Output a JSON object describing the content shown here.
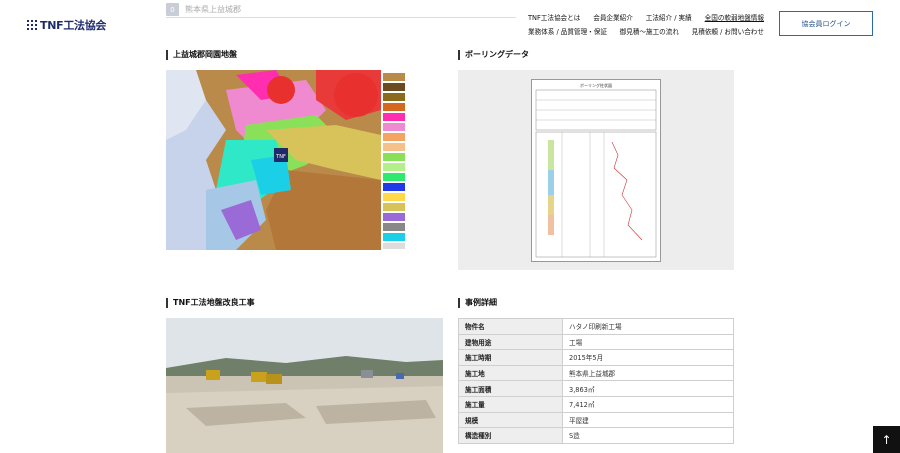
{
  "logo": {
    "text": "TNF工法協会"
  },
  "breadcrumb": {
    "icon": "0",
    "text": "熊本県上益城郡"
  },
  "nav": {
    "row1": [
      "TNF工法協会とは",
      "会員企業紹介",
      "工法紹介 / 実績",
      "全国の軟弱地盤情報"
    ],
    "row2": [
      "業務体系 / 品質管理・保証",
      "御見積～施工の流れ",
      "見積依頼 / お問い合わせ"
    ],
    "active": "全国の軟弱地盤情報"
  },
  "login_button": "協会員ログイン",
  "sections": {
    "map_title": "上益城郡岡園地盤",
    "boring_title": "ボーリングデータ",
    "photo_title": "TNF工法地盤改良工事",
    "detail_title": "事例詳細"
  },
  "map": {
    "marker": "TNF"
  },
  "boring": {
    "sheet_title": "ボーリング柱状図"
  },
  "details": [
    {
      "label": "物件名",
      "value": "ハタノ印刷新工場"
    },
    {
      "label": "建物用途",
      "value": "工場"
    },
    {
      "label": "施工時期",
      "value": "2015年5月"
    },
    {
      "label": "施工地",
      "value": "熊本県上益城郡"
    },
    {
      "label": "施工面積",
      "value": "3,863㎡"
    },
    {
      "label": "施工量",
      "value": "7,412㎥"
    },
    {
      "label": "規模",
      "value": "平屋建"
    },
    {
      "label": "構造種別",
      "value": "S造"
    }
  ],
  "colors": {
    "brand": "#1f2a6b",
    "login_border": "#2a6aa8"
  },
  "icons": {
    "scroll_top": "arrow-up-icon"
  }
}
